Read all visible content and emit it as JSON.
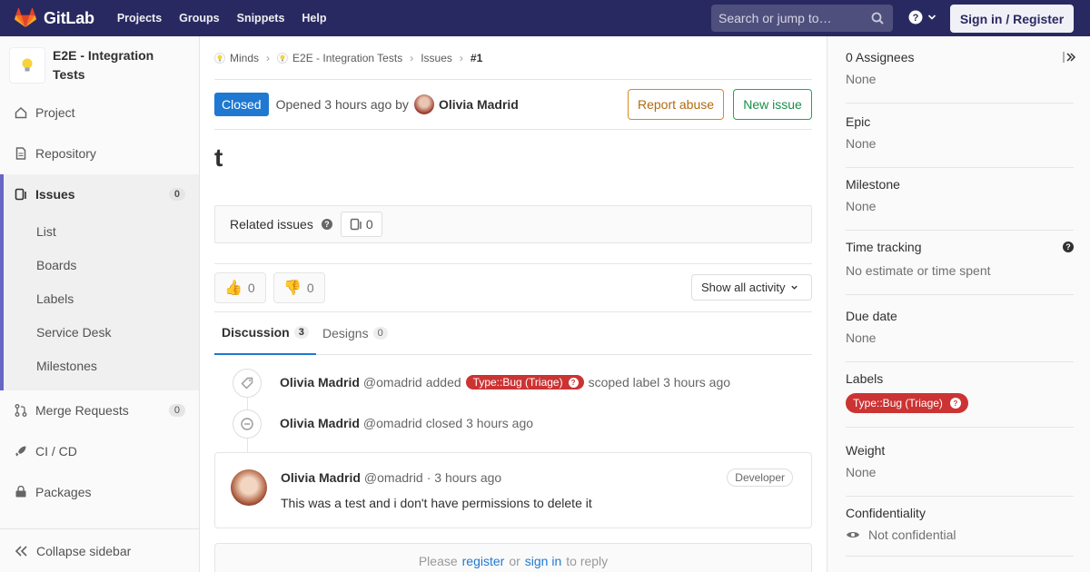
{
  "navbar": {
    "brand": "GitLab",
    "links": [
      "Projects",
      "Groups",
      "Snippets",
      "Help"
    ],
    "search_placeholder": "Search or jump to…",
    "signin": "Sign in / Register"
  },
  "sidebar": {
    "project_name": "E2E - Integration Tests",
    "items": [
      {
        "label": "Project"
      },
      {
        "label": "Repository"
      },
      {
        "label": "Issues",
        "badge": "0"
      },
      {
        "label": "Merge Requests",
        "badge": "0"
      },
      {
        "label": "CI / CD"
      },
      {
        "label": "Packages"
      }
    ],
    "issue_subitems": [
      "List",
      "Boards",
      "Labels",
      "Service Desk",
      "Milestones"
    ],
    "collapse": "Collapse sidebar"
  },
  "breadcrumb": [
    "Minds",
    "E2E - Integration Tests",
    "Issues",
    "#1"
  ],
  "issue": {
    "status": "Closed",
    "opened_text": "Opened 3 hours ago by",
    "author": "Olivia Madrid",
    "report_abuse": "Report abuse",
    "new_issue": "New issue",
    "title": "t"
  },
  "related": {
    "label": "Related issues",
    "count": "0"
  },
  "awards": {
    "thumbs_up": "0",
    "thumbs_down": "0"
  },
  "activity_filter": "Show all activity",
  "tabs": [
    {
      "label": "Discussion",
      "count": "3"
    },
    {
      "label": "Designs",
      "count": "0"
    }
  ],
  "timeline": [
    {
      "name": "Olivia Madrid",
      "handle": "@omadrid",
      "pre": "added",
      "label": "Type::Bug (Triage)",
      "post": "scoped label 3 hours ago"
    },
    {
      "name": "Olivia Madrid",
      "handle": "@omadrid",
      "pre": "closed 3 hours ago"
    }
  ],
  "note": {
    "name": "Olivia Madrid",
    "handle": "@omadrid",
    "time": "· 3 hours ago",
    "role": "Developer",
    "body": "This was a test and i don't have permissions to delete it"
  },
  "reply": {
    "please": "Please",
    "register": "register",
    "or": "or",
    "signin": "sign in",
    "suffix": "to reply"
  },
  "right_sidebar": {
    "assignees": {
      "title": "0 Assignees",
      "value": "None"
    },
    "epic": {
      "title": "Epic",
      "value": "None"
    },
    "milestone": {
      "title": "Milestone",
      "value": "None"
    },
    "time_tracking": {
      "title": "Time tracking",
      "value": "No estimate or time spent"
    },
    "due_date": {
      "title": "Due date",
      "value": "None"
    },
    "labels": {
      "title": "Labels",
      "value": "Type::Bug (Triage)"
    },
    "weight": {
      "title": "Weight",
      "value": "None"
    },
    "confidentiality": {
      "title": "Confidentiality",
      "value": "Not confidential"
    }
  },
  "colors": {
    "navbar": "#292961",
    "closed": "#1f78d1",
    "label_red": "#cc3333",
    "sidebar_accent": "#6666c4"
  }
}
